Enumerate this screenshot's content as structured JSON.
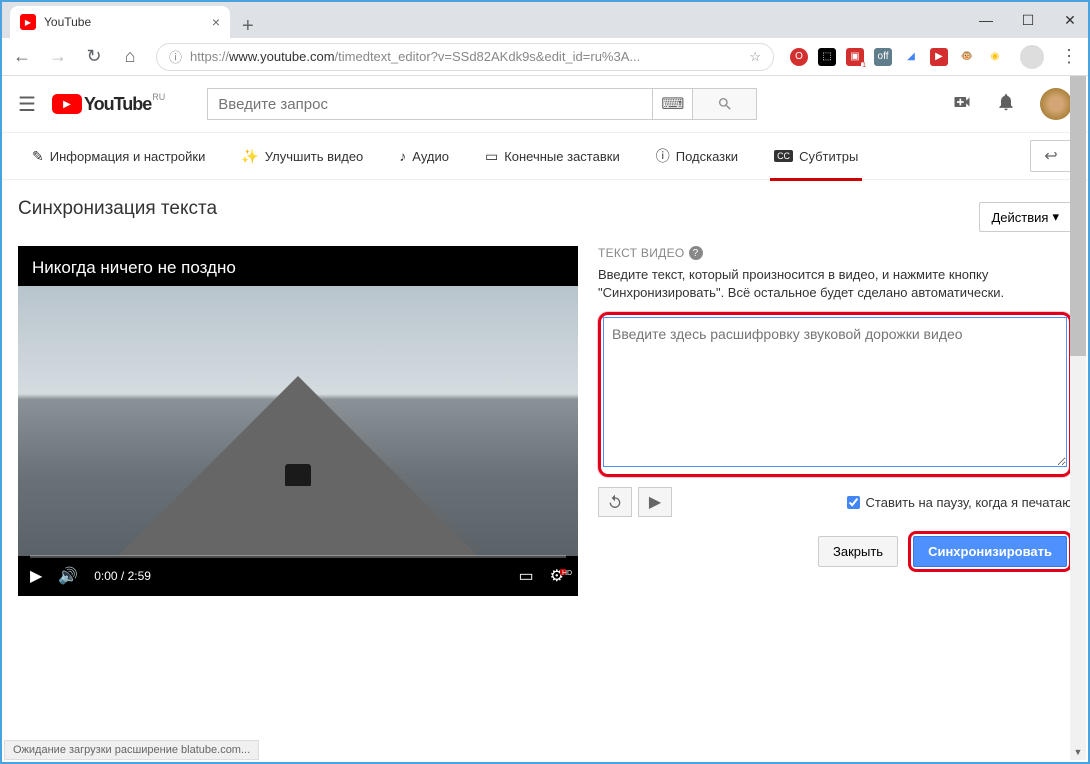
{
  "browser": {
    "tab_title": "YouTube",
    "url_prefix": "https://",
    "url_host": "www.youtube.com",
    "url_path": "/timedtext_editor?v=SSd82AKdk9s&edit_id=ru%3A...",
    "status_text": "Ожидание загрузки расширение blatube.com..."
  },
  "yt_header": {
    "logo_text": "YouTube",
    "region": "RU",
    "search_placeholder": "Введите запрос"
  },
  "editor_tabs": {
    "info": "Информация и настройки",
    "enhance": "Улучшить видео",
    "audio": "Аудио",
    "endscreens": "Конечные заставки",
    "cards": "Подсказки",
    "subtitles": "Субтитры"
  },
  "page": {
    "heading": "Синхронизация текста",
    "video_title": "Никогда ничего не поздно",
    "time_display": "0:00 / 2:59",
    "actions_label": "Действия",
    "section_label": "ТЕКСТ ВИДЕО",
    "section_desc": "Введите текст, который произносится в видео, и нажмите кнопку \"Синхронизировать\". Всё остальное будет сделано автоматически.",
    "textarea_placeholder": "Введите здесь расшифровку звуковой дорожки видео",
    "pause_checkbox": "Ставить на паузу, когда я печатаю",
    "close_btn": "Закрыть",
    "sync_btn": "Синхронизировать"
  }
}
